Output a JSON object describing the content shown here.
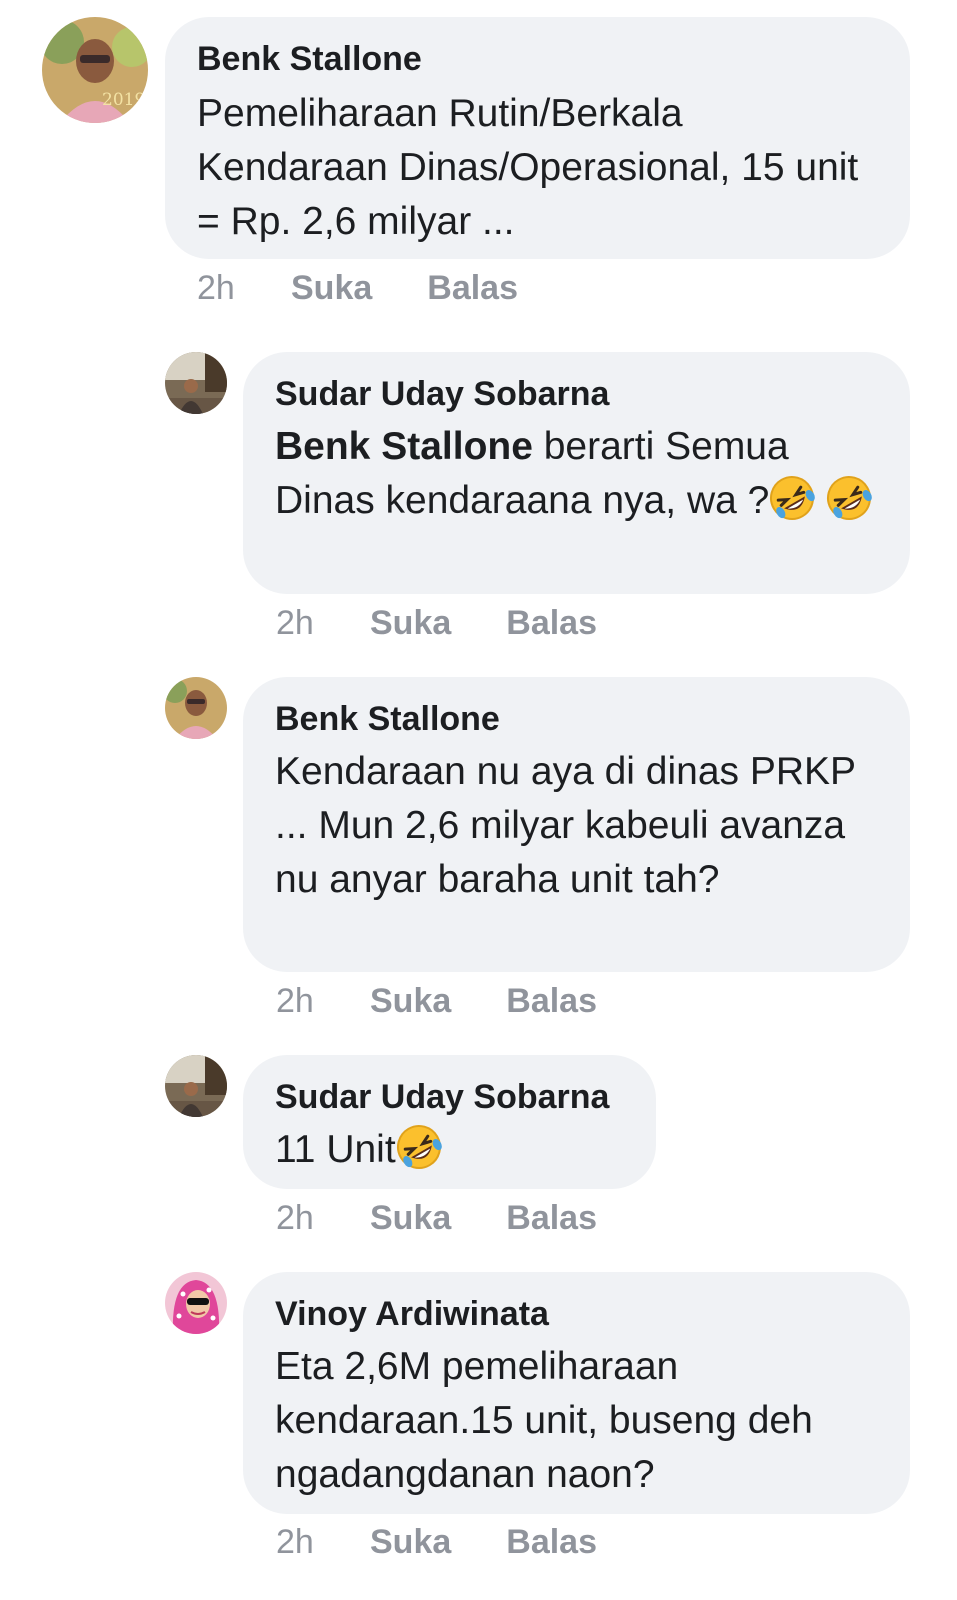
{
  "comments": [
    {
      "author": "Benk Stallone",
      "text": "Pemeliharaan Rutin/Berkala Kendaraan Dinas/Operasional, 15 unit = Rp. 2,6 milyar ...",
      "time": "2h",
      "like_label": "Suka",
      "reply_label": "Balas",
      "avatar_caption": "2019"
    },
    {
      "author": "Sudar Uday Sobarna",
      "mention": "Benk Stallone",
      "text": " berarti Semua Dinas kendaraana nya, wa ?",
      "emoji": [
        "rolling-on-floor-laughing",
        "rolling-on-floor-laughing"
      ],
      "time": "2h",
      "like_label": "Suka",
      "reply_label": "Balas"
    },
    {
      "author": "Benk Stallone",
      "text": "Kendaraan nu aya di dinas PRKP ... Mun 2,6 milyar kabeuli avanza nu anyar baraha unit tah?",
      "time": "2h",
      "like_label": "Suka",
      "reply_label": "Balas"
    },
    {
      "author": "Sudar Uday Sobarna",
      "text": "11 Unit",
      "emoji": [
        "rolling-on-floor-laughing"
      ],
      "time": "2h",
      "like_label": "Suka",
      "reply_label": "Balas"
    },
    {
      "author": "Vinoy Ardiwinata",
      "text": "Eta 2,6M pemeliharaan kendaraan.15 unit, buseng deh ngadangdanan naon?",
      "time": "2h",
      "like_label": "Suka",
      "reply_label": "Balas"
    }
  ],
  "colors": {
    "bubble_bg": "#f0f2f5",
    "text": "#1c1e21",
    "meta": "#90949c",
    "emoji_yellow": "#fbc02d"
  }
}
